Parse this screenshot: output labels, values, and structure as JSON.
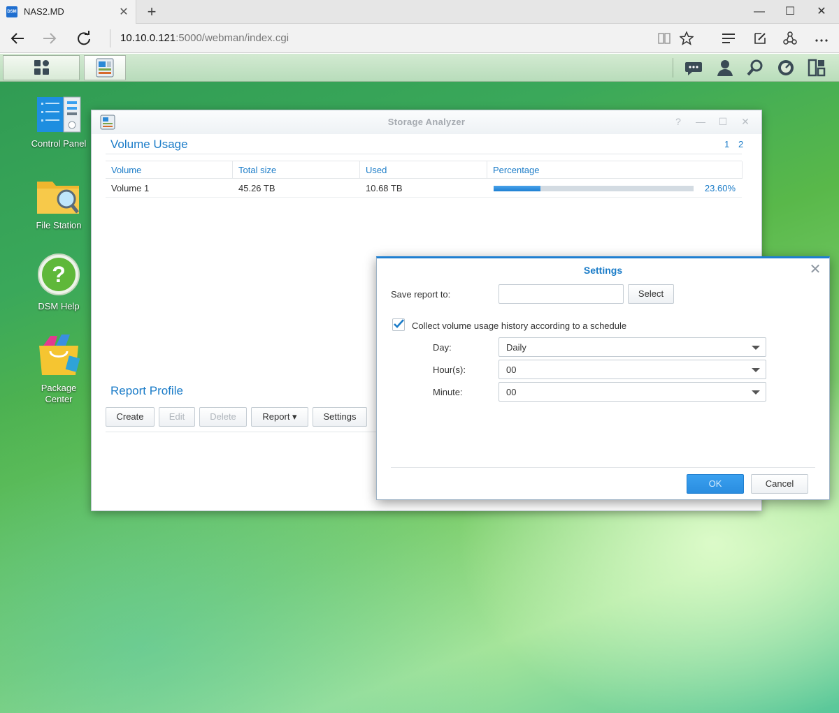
{
  "browser": {
    "tab_title": "NAS2.MD",
    "favicon_text": "DSM",
    "new_tab_label": "+",
    "tab_close_label": "✕",
    "url_host": "10.10.0.121",
    "url_rest": ":5000/webman/index.cgi",
    "icons": [
      "back-icon",
      "forward-icon",
      "refresh-icon",
      "reading-view-icon",
      "favorite-star-icon",
      "hub-icon",
      "web-note-icon",
      "share-icon",
      "more-icon"
    ]
  },
  "window_controls": {
    "minimize": "—",
    "maximize": "☐",
    "close": "✕"
  },
  "dsm": {
    "taskbar_icons": [
      "main-menu-icon",
      "storage-analyzer-app-icon",
      "notifications-icon",
      "user-icon",
      "search-icon",
      "resource-monitor-icon",
      "widgets-icon"
    ],
    "desktop_icons": [
      {
        "label": "Control Panel",
        "icon": "control-panel-icon"
      },
      {
        "label": "File Station",
        "icon": "file-station-icon"
      },
      {
        "label": "DSM Help",
        "icon": "help-icon"
      },
      {
        "label": "Package\nCenter",
        "icon": "package-center-icon"
      }
    ]
  },
  "storage_window": {
    "title": "Storage Analyzer",
    "controls": {
      "help": "?",
      "minimize": "—",
      "maximize": "☐",
      "close": "✕"
    },
    "volume_usage": {
      "title": "Volume Usage",
      "pages": [
        "1",
        "2"
      ],
      "columns": [
        "Volume",
        "Total size",
        "Used",
        "Percentage"
      ],
      "rows": [
        {
          "volume": "Volume 1",
          "total": "45.26 TB",
          "used": "10.68 TB",
          "percentage": "23.60%",
          "fraction": 0.236
        }
      ]
    },
    "report_profile": {
      "title": "Report Profile",
      "buttons": {
        "create": "Create",
        "edit": "Edit",
        "delete": "Delete",
        "report": "Report ▾",
        "settings": "Settings"
      }
    }
  },
  "settings_dialog": {
    "title": "Settings",
    "close": "✕",
    "save_report_label": "Save report to:",
    "save_report_value": "",
    "select_button": "Select",
    "collect_checkbox_label": "Collect volume usage history according to a schedule",
    "collect_checked": true,
    "day_label": "Day:",
    "day_value": "Daily",
    "hours_label": "Hour(s):",
    "hours_value": "00",
    "minute_label": "Minute:",
    "minute_value": "00",
    "ok_button": "OK",
    "cancel_button": "Cancel"
  },
  "colors": {
    "accent": "#1b7cc8",
    "primary_button": "#2a8de0",
    "progress_fill": "#1d7fd2"
  }
}
